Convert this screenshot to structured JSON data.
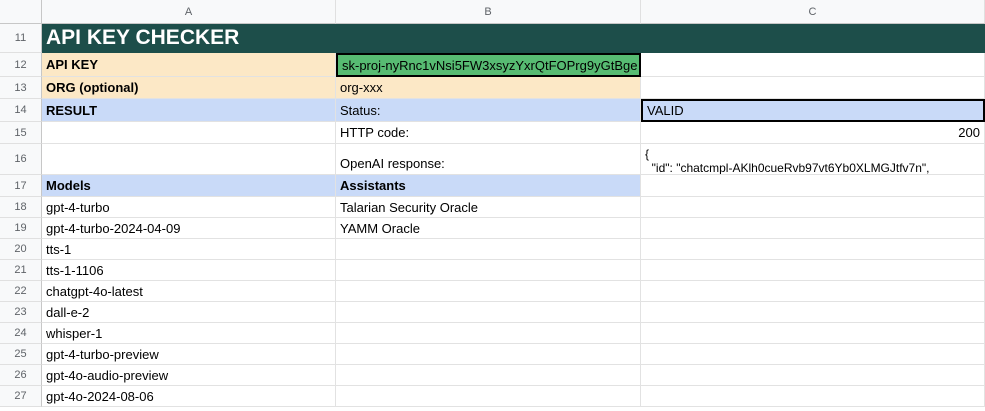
{
  "columns": [
    "A",
    "B",
    "C"
  ],
  "rows": [
    "11",
    "12",
    "13",
    "14",
    "15",
    "16",
    "17",
    "18",
    "19",
    "20",
    "21",
    "22",
    "23",
    "24",
    "25",
    "26",
    "27"
  ],
  "title": "API KEY CHECKER",
  "labels": {
    "api_key": "API KEY",
    "org": "ORG (optional)",
    "result": "RESULT",
    "status": "Status:",
    "http_code": "HTTP code:",
    "openai_response": "OpenAI response:",
    "models": "Models",
    "assistants": "Assistants"
  },
  "values": {
    "api_key": "sk-proj-nyRnc1vNsi5FW3xsyzYxrQtFOPrg9yGtBge",
    "org": "org-xxx",
    "status": "VALID",
    "http_code": "200",
    "response_line1": "{",
    "response_line2": "  \"id\": \"chatcmpl-AKlh0cueRvb97vt6Yb0XLMGJtfv7n\","
  },
  "models": [
    "gpt-4-turbo",
    "gpt-4-turbo-2024-04-09",
    "tts-1",
    "tts-1-1106",
    "chatgpt-4o-latest",
    "dall-e-2",
    "whisper-1",
    "gpt-4-turbo-preview",
    "gpt-4o-audio-preview",
    "gpt-4o-2024-08-06"
  ],
  "assistants": [
    "Talarian Security Oracle",
    "YAMM Oracle"
  ],
  "colors": {
    "title_bg": "#1d4e4a",
    "beige": "#fce8c6",
    "blue": "#c9daf8",
    "key_green": "#57bb72"
  }
}
